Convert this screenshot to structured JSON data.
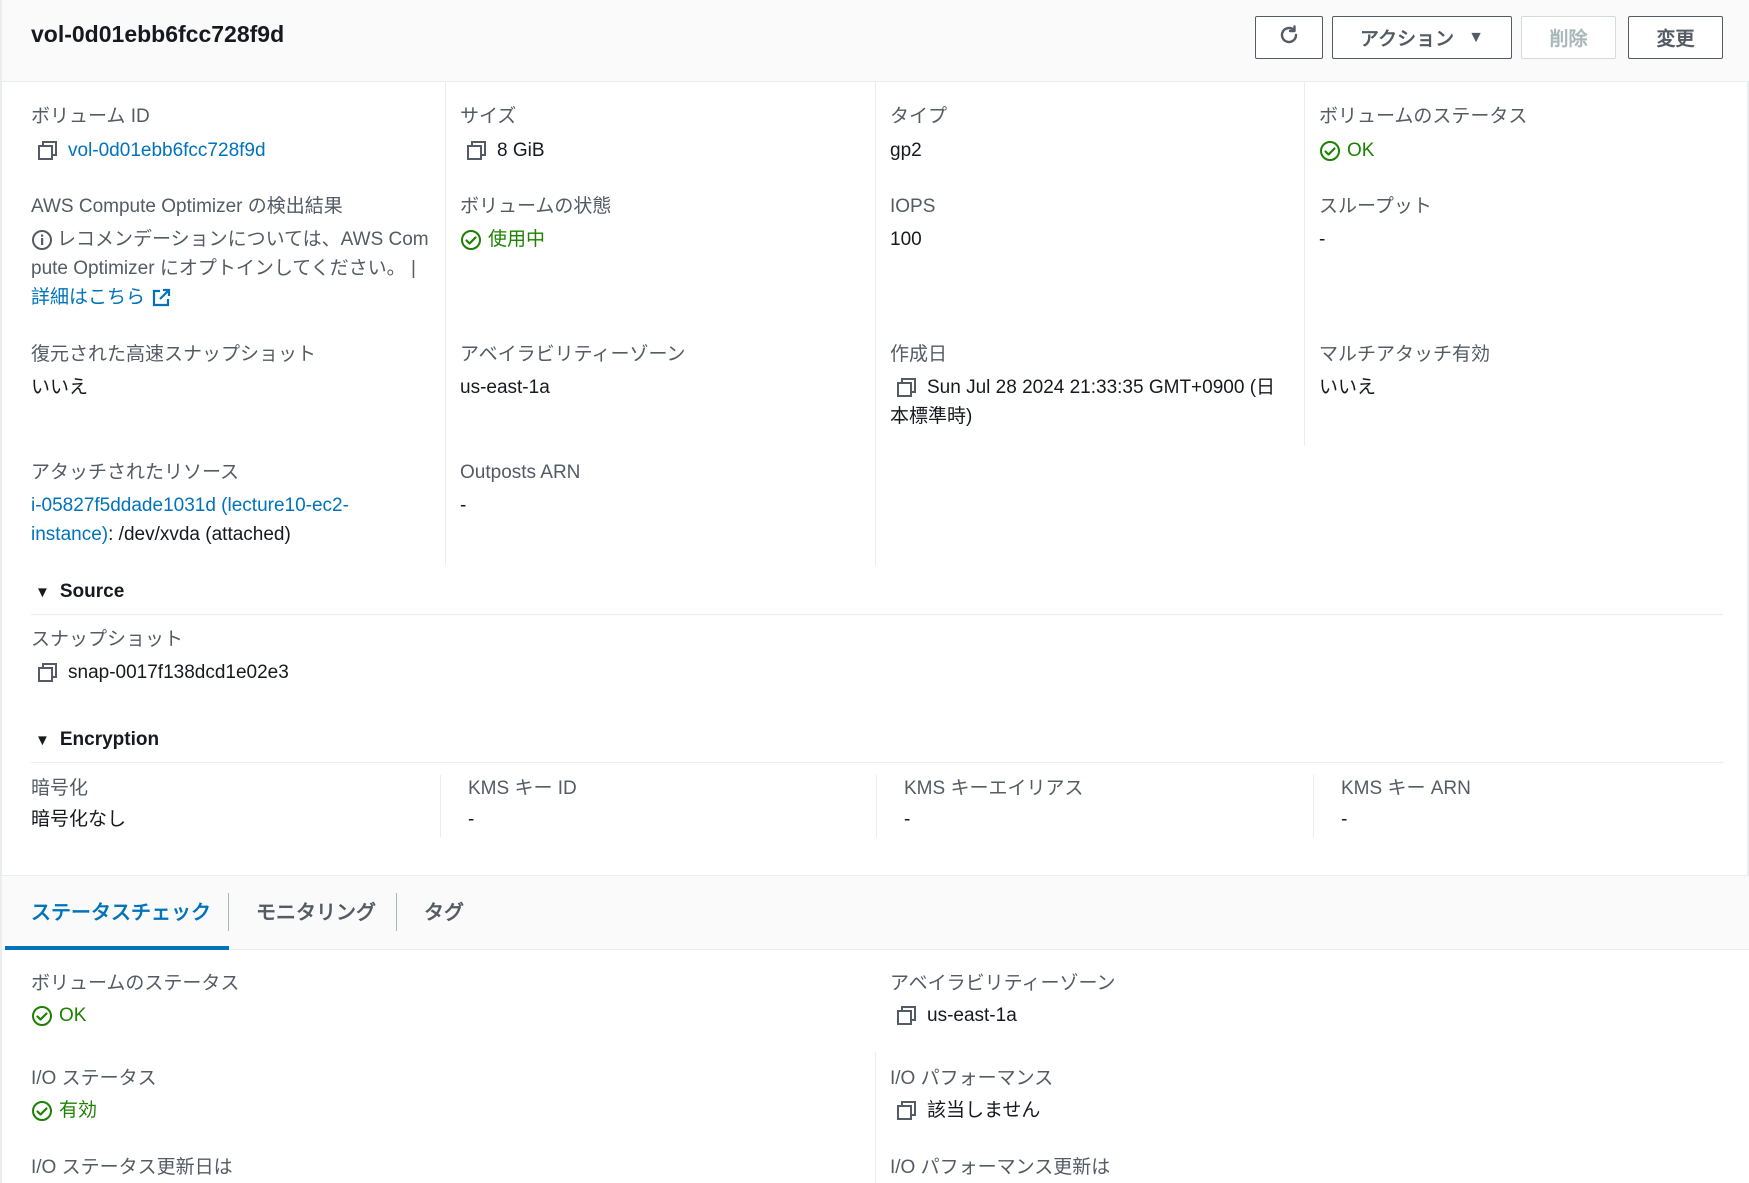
{
  "header": {
    "title": "vol-0d01ebb6fcc728f9d",
    "actions_label": "アクション",
    "delete_label": "削除",
    "edit_label": "変更"
  },
  "details": {
    "volume_id": {
      "label": "ボリューム ID",
      "value": "vol-0d01ebb6fcc728f9d"
    },
    "size": {
      "label": "サイズ",
      "value": "8 GiB"
    },
    "type": {
      "label": "タイプ",
      "value": "gp2"
    },
    "volume_status": {
      "label": "ボリュームのステータス",
      "value": "OK"
    },
    "optimizer": {
      "label": "AWS Compute Optimizer の検出結果",
      "text_line1": "レコメンデーションについては、AWS Com",
      "text_line2": "pute Optimizer にオプトインしてください。 |",
      "link": "詳細はこちら"
    },
    "volume_state": {
      "label": "ボリュームの状態",
      "value": "使用中"
    },
    "iops": {
      "label": "IOPS",
      "value": "100"
    },
    "throughput": {
      "label": "スループット",
      "value": "-"
    },
    "fast_snapshot": {
      "label": "復元された高速スナップショット",
      "value": "いいえ"
    },
    "az": {
      "label": "アベイラビリティーゾーン",
      "value": "us-east-1a"
    },
    "created": {
      "label": "作成日",
      "value_line1": "Sun Jul 28 2024 21:33:35 GMT+0900 (日",
      "value_line2": "本標準時)"
    },
    "multi_attach": {
      "label": "マルチアタッチ有効",
      "value": "いいえ"
    },
    "attached": {
      "label": "アタッチされたリソース",
      "link_line1": "i-05827f5ddade1031d (lecture10-ec2-",
      "link_line2": "instance)",
      "suffix": ": /dev/xvda (attached)"
    },
    "outposts": {
      "label": "Outposts ARN",
      "value": "-"
    }
  },
  "source": {
    "title": "Source",
    "snapshot_label": "スナップショット",
    "snapshot_value": "snap-0017f138dcd1e02e3"
  },
  "encryption": {
    "title": "Encryption",
    "encrypted": {
      "label": "暗号化",
      "value": "暗号化なし"
    },
    "kms_id": {
      "label": "KMS キー ID",
      "value": "-"
    },
    "kms_alias": {
      "label": "KMS キーエイリアス",
      "value": "-"
    },
    "kms_arn": {
      "label": "KMS キー ARN",
      "value": "-"
    }
  },
  "tabs": [
    "ステータスチェック",
    "モニタリング",
    "タグ"
  ],
  "status_check": {
    "volume_status": {
      "label": "ボリュームのステータス",
      "value": "OK"
    },
    "az": {
      "label": "アベイラビリティーゾーン",
      "value": "us-east-1a"
    },
    "io_status": {
      "label": "I/O ステータス",
      "value": "有効"
    },
    "io_performance": {
      "label": "I/O パフォーマンス",
      "value": "該当しません"
    },
    "io_status_updated": {
      "label": "I/O ステータス更新日は"
    },
    "io_performance_updated": {
      "label": "I/O パフォーマンス更新は"
    }
  },
  "colors": {
    "link": "#0073bb",
    "success": "#1d8102",
    "text": "#16191f",
    "label": "#545b64",
    "border": "#eaeded"
  }
}
